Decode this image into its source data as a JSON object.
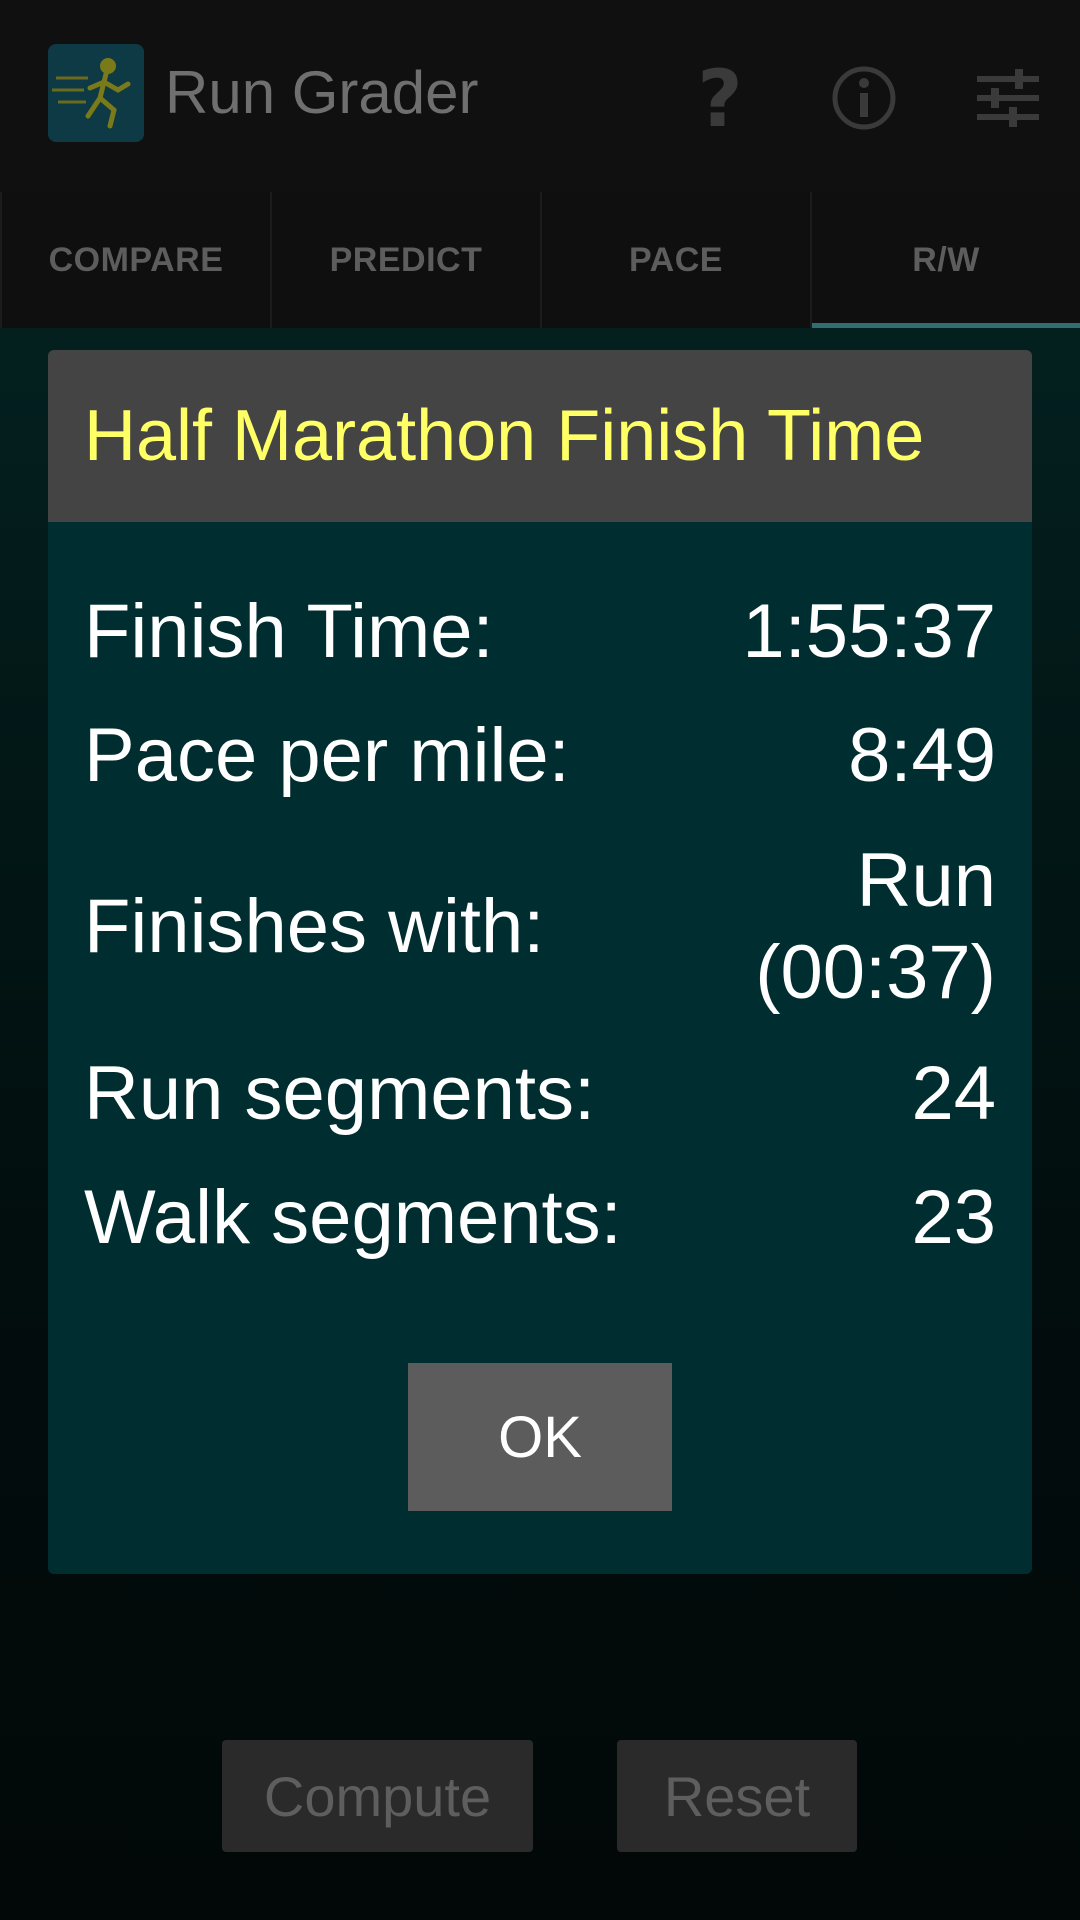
{
  "app": {
    "title": "Run Grader",
    "logo_icon": "running-man-icon",
    "actions": [
      {
        "name": "help-icon"
      },
      {
        "name": "info-icon"
      },
      {
        "name": "settings-sliders-icon"
      }
    ]
  },
  "tabs": [
    {
      "label": "COMPARE"
    },
    {
      "label": "PREDICT"
    },
    {
      "label": "PACE"
    },
    {
      "label": "R/W",
      "active": true
    }
  ],
  "bottom_buttons": {
    "compute": "Compute",
    "reset": "Reset"
  },
  "dialog": {
    "title": "Half Marathon Finish Time",
    "rows": [
      {
        "label": "Finish Time:",
        "value": "1:55:37"
      },
      {
        "label": "Pace per mile:",
        "value": "8:49"
      },
      {
        "label": "Finishes with:",
        "value_line1": "Run",
        "value_line2": "(00:37)"
      },
      {
        "label": "Run segments:",
        "value": "24"
      },
      {
        "label": "Walk segments:",
        "value": "23"
      }
    ],
    "ok": "OK"
  },
  "colors": {
    "dialog_bg": "#002e30",
    "dialog_header_bg": "#444444",
    "title_yellow": "#ffff66",
    "tab_indicator": "#2f6f6f"
  }
}
